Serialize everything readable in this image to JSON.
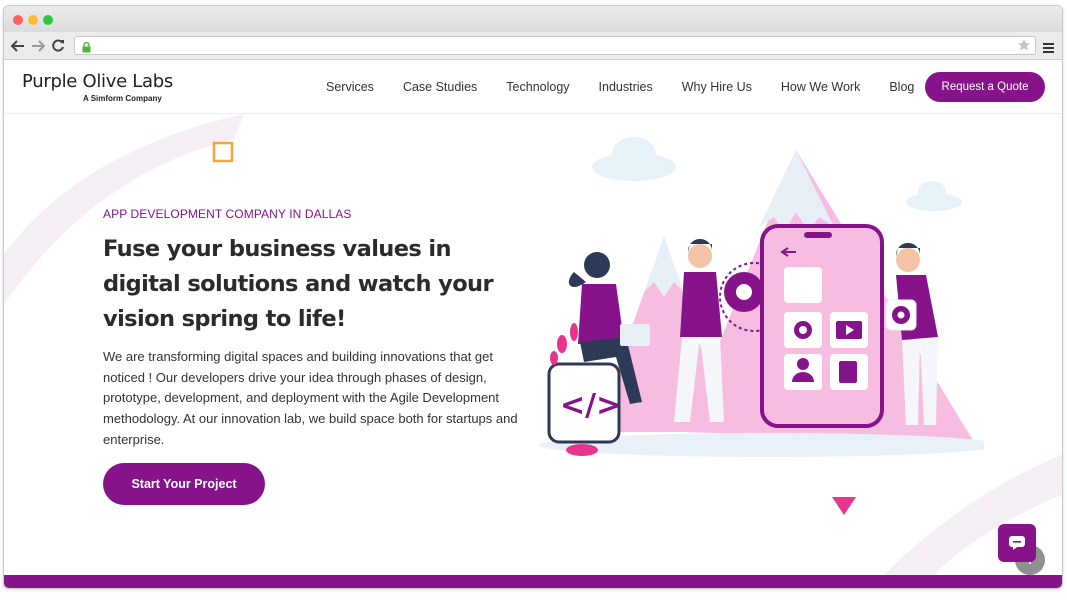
{
  "browser": {
    "url": ""
  },
  "header": {
    "logo_title": "Purple Olive Labs",
    "logo_subtitle": "A Simform Company",
    "nav": [
      "Services",
      "Case Studies",
      "Technology",
      "Industries",
      "Why Hire Us",
      "How We Work",
      "Blog"
    ],
    "cta_label": "Request a Quote"
  },
  "hero": {
    "eyebrow": "APP DEVELOPMENT COMPANY IN DALLAS",
    "headline": "Fuse your business values in digital solutions and watch your vision spring to life!",
    "body": "We are transforming digital spaces and building innovations that get noticed ! Our developers drive your idea through phases of design, prototype, development, and deployment with the Agile Development methodology. At our innovation lab, we build space both for startups and enterprise.",
    "button_label": "Start Your Project",
    "code_glyph": "</>"
  },
  "colors": {
    "brand": "#861389",
    "accent_pink": "#f5b3dc",
    "magenta": "#e7358f"
  }
}
